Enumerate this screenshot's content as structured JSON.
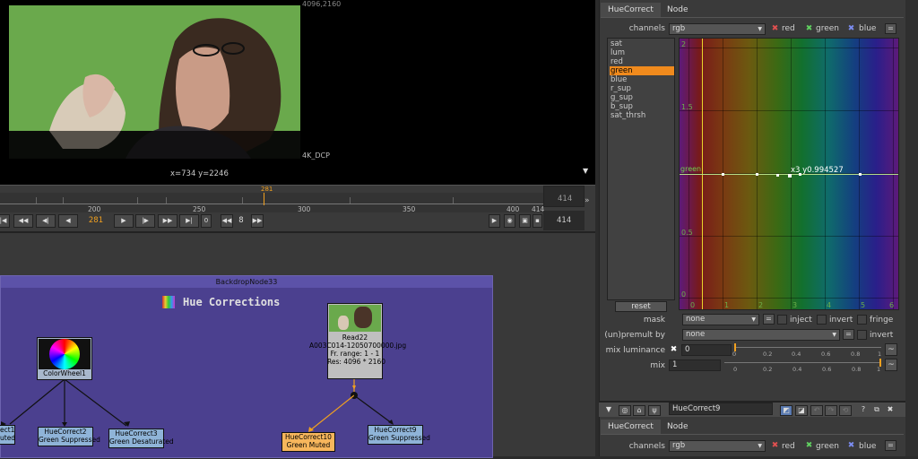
{
  "viewer": {
    "resolution_label": "4096,2160",
    "format_label": "4K_DCP",
    "coords": "x=734 y=2246"
  },
  "timeline": {
    "ticks": [
      "200",
      "250",
      "300",
      "350",
      "400",
      "414"
    ],
    "current_marker": "281",
    "current_frame": "281",
    "end_frame": "414",
    "end_frame_2": "414",
    "step_value": "8",
    "step_mode": "0"
  },
  "graph": {
    "backdrop_label": "BackdropNode33",
    "backdrop_title": "Hue Corrections",
    "nodes": {
      "colorwheel": "ColorWheel1",
      "read_name": "Read22",
      "read_file": "A003C014-12050700000.jpg",
      "read_range": "Fr. range: 1 - 1",
      "read_res": "Res: 4096 * 2160",
      "hc_left_a": "ect1",
      "hc_left_b": "uted",
      "hc2_a": "HueCorrect2",
      "hc2_b": "Green Suppressed",
      "hc3_a": "HueCorrect3",
      "hc3_b": "Green Desaturated",
      "hc10_a": "HueCorrect10",
      "hc10_b": "Green Muted",
      "hc9_a": "HueCorrect9",
      "hc9_b": "Green Suppressed"
    }
  },
  "props": {
    "tab_huecorrect": "HueCorrect",
    "tab_node": "Node",
    "channels_label": "channels",
    "channels_value": "rgb",
    "red": "red",
    "green": "green",
    "blue": "blue",
    "curves": [
      "sat",
      "lum",
      "red",
      "green",
      "blue",
      "r_sup",
      "g_sup",
      "b_sup",
      "sat_thrsh"
    ],
    "selected_curve": "green",
    "reset": "reset",
    "curve_y_labels": [
      "2",
      "1.5",
      "0.5",
      "0"
    ],
    "curve_x_labels": [
      "0",
      "1",
      "2",
      "3",
      "4",
      "5",
      "6"
    ],
    "curve_name": "green",
    "point_readout": "x3 y0.994527",
    "mask_label": "mask",
    "mask_value": "none",
    "inject": "inject",
    "invert": "invert",
    "fringe": "fringe",
    "unpremult_label": "(un)premult by",
    "unpremult_value": "none",
    "invert2": "invert",
    "mixlum_label": "mix luminance",
    "mixlum_value": "0",
    "mix_label": "mix",
    "mix_value": "1",
    "slider_ticks": [
      "0",
      "0.2",
      "0.4",
      "0.6",
      "0.8",
      "1"
    ],
    "node2_name": "HueCorrect9",
    "tab2_huecorrect": "HueCorrect",
    "tab2_node": "Node",
    "channels2_label": "channels",
    "channels2_value": "rgb",
    "red2": "red",
    "green2": "green",
    "blue2": "blue"
  }
}
